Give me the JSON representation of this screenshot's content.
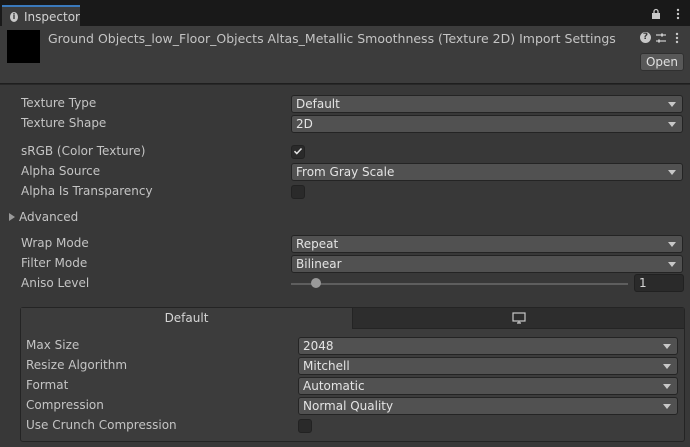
{
  "tab": {
    "label": "Inspector"
  },
  "header": {
    "title": "Ground Objects_low_Floor_Objects Altas_Metallic Smoothness (Texture 2D) Import Settings",
    "open_label": "Open"
  },
  "fields": {
    "texture_type": {
      "label": "Texture Type",
      "value": "Default"
    },
    "texture_shape": {
      "label": "Texture Shape",
      "value": "2D"
    },
    "srgb": {
      "label": "sRGB (Color Texture)",
      "checked": true
    },
    "alpha_source": {
      "label": "Alpha Source",
      "value": "From Gray Scale"
    },
    "alpha_is_transparency": {
      "label": "Alpha Is Transparency",
      "checked": false
    },
    "advanced": {
      "label": "Advanced"
    },
    "wrap_mode": {
      "label": "Wrap Mode",
      "value": "Repeat"
    },
    "filter_mode": {
      "label": "Filter Mode",
      "value": "Bilinear"
    },
    "aniso_level": {
      "label": "Aniso Level",
      "value": "1"
    }
  },
  "platform": {
    "tabs": {
      "default": "Default",
      "standalone_icon": "monitor-icon"
    },
    "max_size": {
      "label": "Max Size",
      "value": "2048"
    },
    "resize_algorithm": {
      "label": "Resize Algorithm",
      "value": "Mitchell"
    },
    "format": {
      "label": "Format",
      "value": "Automatic"
    },
    "compression": {
      "label": "Compression",
      "value": "Normal Quality"
    },
    "use_crunch": {
      "label": "Use Crunch Compression",
      "checked": false
    }
  },
  "colors": {
    "accent": "#3a79bb",
    "background": "#383838"
  }
}
